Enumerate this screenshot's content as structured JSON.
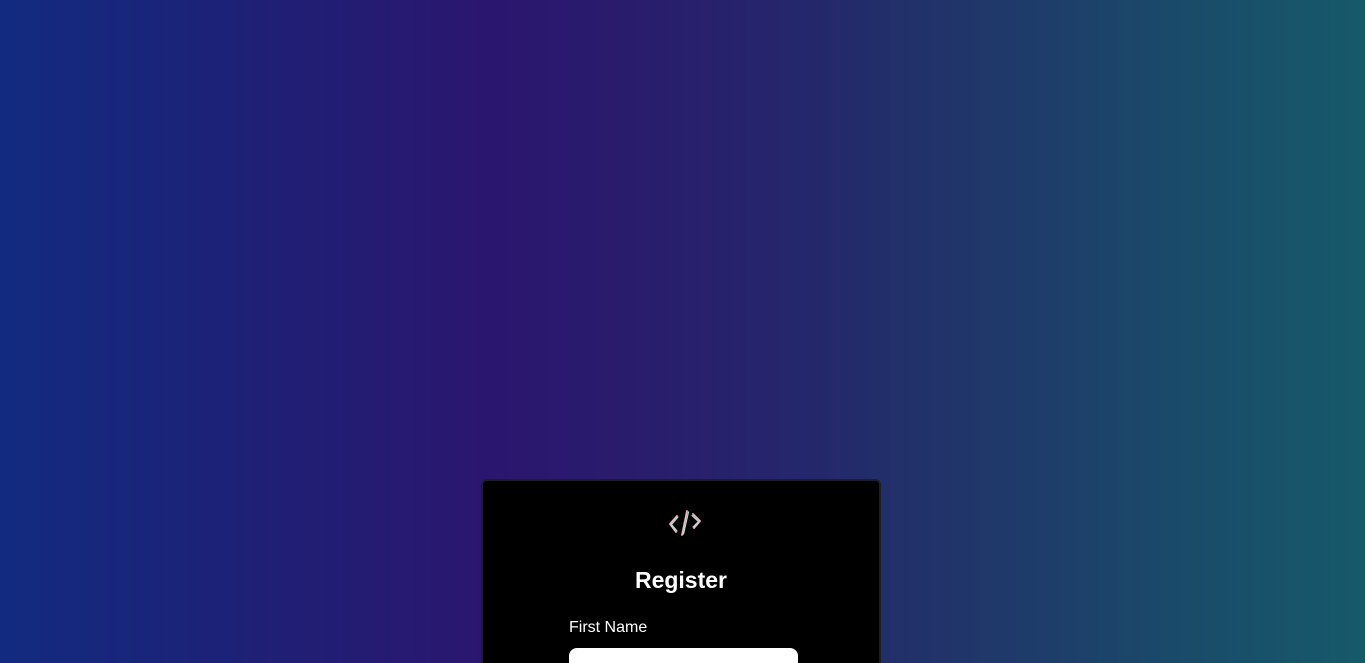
{
  "register_form": {
    "title": "Register",
    "logo_icon": "code-brackets-logo-icon",
    "first_name": {
      "label": "First Name",
      "value": "",
      "placeholder": ""
    }
  },
  "colors": {
    "card_background": "#000000",
    "title_text": "#ffffff",
    "input_background": "#ffffff",
    "logo_stroke_a": "#f4b6c8",
    "logo_stroke_b": "#a8e6d8"
  }
}
